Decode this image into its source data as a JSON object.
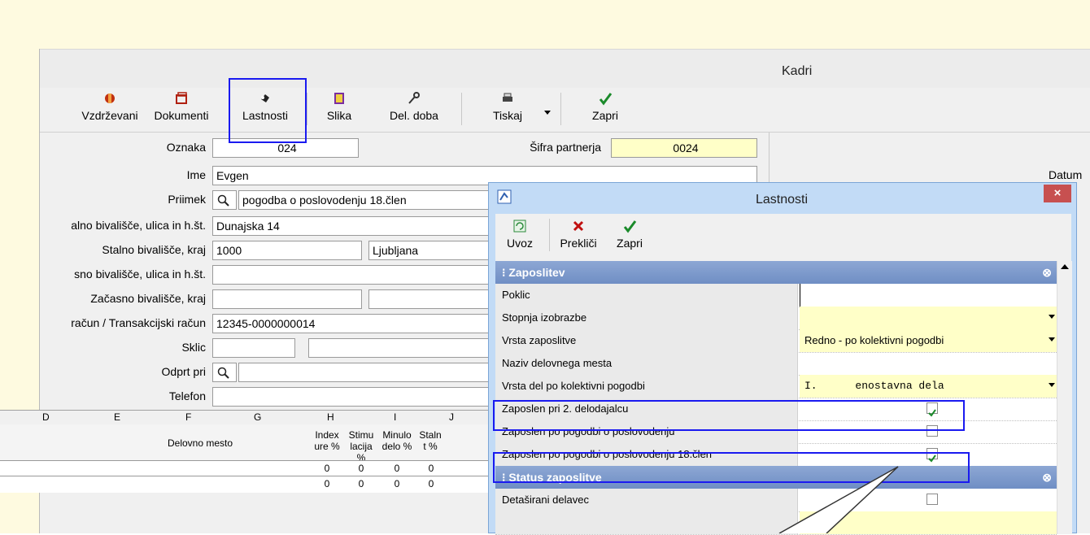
{
  "window": {
    "title": "Kadri"
  },
  "toolbar": {
    "vzdrzevani": "Vzdrževani",
    "dokumenti": "Dokumenti",
    "lastnosti": "Lastnosti",
    "slika": "Slika",
    "del_doba": "Del. doba",
    "tiskaj": "Tiskaj",
    "zapri": "Zapri"
  },
  "form": {
    "oznaka_label": "Oznaka",
    "oznaka_value": "024",
    "sifra_label": "Šifra partnerja",
    "sifra_value": "0024",
    "datum_label": "Datum",
    "ime_label": "Ime",
    "ime_value": "Evgen",
    "priimek_label": "Priimek",
    "priimek_value": "pogodba o poslovodenju 18.člen",
    "stalno_ulica_label": "alno bivališče, ulica in h.št.",
    "stalno_ulica_value": "Dunajska 14",
    "stalno_kraj_label": "Stalno bivališče, kraj",
    "stalno_kraj_posta": "1000",
    "stalno_kraj_value": "Ljubljana",
    "zacasno_ulica_label": "sno bivališče, ulica in h.št.",
    "zacasno_kraj_label": "Začasno bivališče, kraj",
    "racun_label": "račun / Transakcijski račun",
    "racun_value": "12345-0000000014",
    "sklic_label": "Sklic",
    "odprt_label": "Odprt pri",
    "telefon_label": "Telefon"
  },
  "grid": {
    "columns": [
      "D",
      "E",
      "F",
      "G",
      "H",
      "I",
      "J"
    ],
    "delovno_mesto": "Delovno mesto",
    "index_ure": "Index ure %",
    "stimulacija": "Stimu lacija %",
    "minulo_delo": "Minulo delo %",
    "stalnost": "Staln t %",
    "row1": [
      "0",
      "0",
      "0",
      "0"
    ],
    "row2": [
      "0",
      "0",
      "0",
      "0"
    ]
  },
  "dialog": {
    "title": "Lastnosti",
    "close": "×",
    "uvoz": "Uvoz",
    "preklici": "Prekliči",
    "zapri": "Zapri",
    "section1": "Zaposlitev",
    "section2": "Status zaposlitve",
    "rows": [
      {
        "name": "Poklic",
        "value": ""
      },
      {
        "name": "Stopnja izobrazbe",
        "value": ""
      },
      {
        "name": "Vrsta zaposlitve",
        "value": "Redno - po kolektivni pogodbi"
      },
      {
        "name": "Naziv delovnega mesta",
        "value": ""
      },
      {
        "name": "Vrsta del po kolektivni pogodbi",
        "value": "I.      enostavna dela"
      },
      {
        "name": "Zaposlen pri 2. delodajalcu",
        "checked": true
      },
      {
        "name": "Zaposlen po pogodbi o poslovodenju",
        "checked": false
      },
      {
        "name": "Zaposlen po pogodbi o poslovodenju 18.člen",
        "checked": true
      },
      {
        "name": "Detaširani delavec",
        "checked": false
      }
    ]
  }
}
